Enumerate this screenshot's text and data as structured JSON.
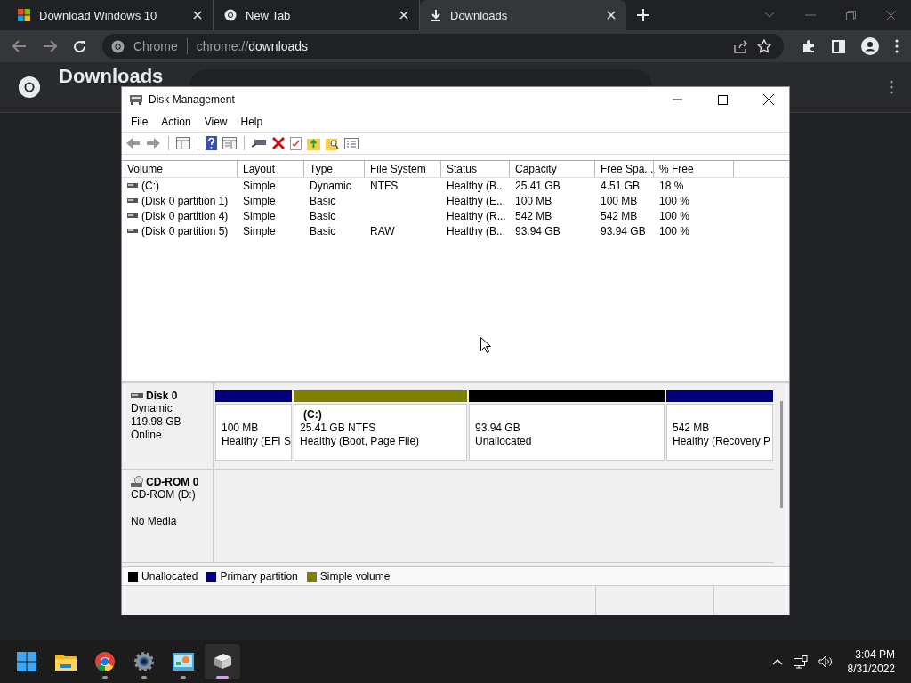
{
  "browser": {
    "tabs": [
      {
        "title": "Download Windows 10",
        "kind": "windows",
        "selected": false
      },
      {
        "title": "New Tab",
        "kind": "chrome",
        "selected": false
      },
      {
        "title": "Downloads",
        "kind": "download",
        "selected": true
      }
    ],
    "address": {
      "site": "Chrome",
      "scheme": "chrome://",
      "host": "downloads"
    },
    "page": {
      "title": "Downloads"
    }
  },
  "dialog": {
    "title": "Disk Management",
    "menu": [
      "File",
      "Action",
      "View",
      "Help"
    ],
    "columns": [
      "Volume",
      "Layout",
      "Type",
      "File System",
      "Status",
      "Capacity",
      "Free Spa...",
      "% Free"
    ],
    "rows": [
      [
        "(C:)",
        "Simple",
        "Dynamic",
        "NTFS",
        "Healthy (B...",
        "25.41 GB",
        "4.51 GB",
        "18 %"
      ],
      [
        "(Disk 0 partition 1)",
        "Simple",
        "Basic",
        "",
        "Healthy (E...",
        "100 MB",
        "100 MB",
        "100 %"
      ],
      [
        "(Disk 0 partition 4)",
        "Simple",
        "Basic",
        "",
        "Healthy (R...",
        "542 MB",
        "542 MB",
        "100 %"
      ],
      [
        "(Disk 0 partition 5)",
        "Simple",
        "Basic",
        "RAW",
        "Healthy (B...",
        "93.94 GB",
        "93.94 GB",
        "100 %"
      ]
    ],
    "disks": [
      {
        "kind": "disk",
        "name": "Disk 0",
        "lines": [
          "Dynamic",
          "119.98 GB",
          "Online"
        ],
        "partitions": [
          {
            "color": "#00007f",
            "lines": [
              "100 MB",
              "Healthy (EFI S"
            ]
          },
          {
            "color": "#808000",
            "name": "(C:)",
            "lines": [
              "25.41 GB NTFS",
              "Healthy (Boot, Page File)"
            ]
          },
          {
            "color": "#000000",
            "lines": [
              "93.94 GB",
              "Unallocated"
            ]
          },
          {
            "color": "#00007f",
            "lines": [
              "542 MB",
              "Healthy (Recovery P"
            ]
          }
        ]
      },
      {
        "kind": "cdrom",
        "name": "CD-ROM 0",
        "lines": [
          "CD-ROM (D:)",
          "No Media"
        ]
      }
    ],
    "legend": [
      {
        "label": "Unallocated",
        "color": "#000000"
      },
      {
        "label": "Primary partition",
        "color": "#00007f"
      },
      {
        "label": "Simple volume",
        "color": "#808000"
      }
    ]
  },
  "taskbar": {
    "apps": [
      {
        "kind": "start",
        "running": false,
        "selected": false
      },
      {
        "kind": "explorer",
        "running": false,
        "selected": false
      },
      {
        "kind": "chrome",
        "running": true,
        "selected": false
      },
      {
        "kind": "settings",
        "running": true,
        "selected": false
      },
      {
        "kind": "control",
        "running": true,
        "selected": false
      },
      {
        "kind": "diskmgmt",
        "running": true,
        "selected": true
      }
    ],
    "time": "3:04 PM",
    "date": "8/31/2022"
  }
}
